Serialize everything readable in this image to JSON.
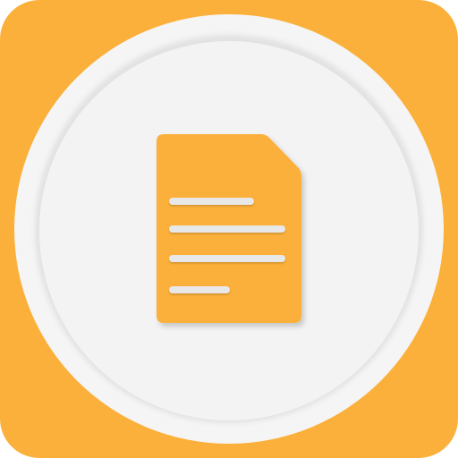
{
  "icon": {
    "name": "document-icon",
    "colors": {
      "tile": "#FBB03B",
      "ring": "#F5F5F5",
      "disc": "#F3F3F3",
      "disc_edge": "#E2E2E2",
      "document": "#FBB03B",
      "text_lines": "#E8E8E8"
    },
    "text_lines": [
      {
        "name": "document-line-1"
      },
      {
        "name": "document-line-2"
      },
      {
        "name": "document-line-3"
      },
      {
        "name": "document-line-4"
      }
    ]
  }
}
